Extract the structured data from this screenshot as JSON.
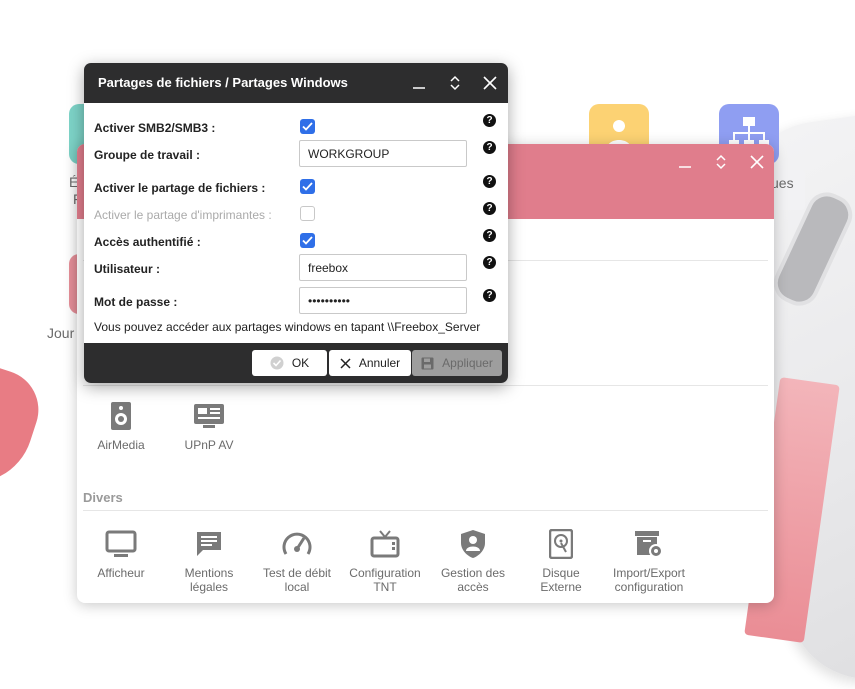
{
  "desktop": {
    "icons": [
      {
        "name": "desktop-icon-user",
        "color": "#fcd273"
      },
      {
        "name": "desktop-icon-network",
        "color": "#8f9ef2"
      }
    ],
    "partial_labels": {
      "left_top": "É",
      "left_mid": "F",
      "left_bottom": "Jour",
      "right": "ues"
    }
  },
  "back_window": {
    "header_color": "#e07d8c",
    "media_items": [
      {
        "label": "AirMedia",
        "icon": "speaker-icon"
      },
      {
        "label": "UPnP AV",
        "icon": "upnp-icon"
      }
    ],
    "sections": {
      "misc_title": "Divers"
    },
    "misc_items": [
      {
        "label": "Afficheur",
        "icon": "monitor-icon"
      },
      {
        "label": "Mentions\nlégales",
        "icon": "comment-icon"
      },
      {
        "label": "Test de débit\nlocal",
        "icon": "gauge-icon"
      },
      {
        "label": "Configuration\nTNT",
        "icon": "tv-icon"
      },
      {
        "label": "Gestion des\naccès",
        "icon": "shield-user-icon"
      },
      {
        "label": "Disque\nExterne",
        "icon": "hard-disk-icon"
      },
      {
        "label": "Import/Export\nconfiguration",
        "icon": "archive-settings-icon"
      }
    ]
  },
  "dialog": {
    "title": "Partages de fichiers / Partages Windows",
    "rows": {
      "smb_label": "Activer SMB2/SMB3 :",
      "smb_checked": true,
      "workgroup_label": "Groupe de travail :",
      "workgroup_value": "WORKGROUP",
      "file_share_label": "Activer le partage de fichiers :",
      "file_share_checked": true,
      "printer_share_label": "Activer le partage d'imprimantes :",
      "printer_share_checked": false,
      "auth_label": "Accès authentifié :",
      "auth_checked": true,
      "user_label": "Utilisateur :",
      "user_value": "freebox",
      "password_label": "Mot de passe :",
      "password_value": "••••••••••"
    },
    "info_text": "Vous pouvez accéder aux partages windows en tapant \\\\Freebox_Server",
    "help_glyph": "?",
    "buttons": {
      "ok": "OK",
      "cancel": "Annuler",
      "apply": "Appliquer"
    }
  },
  "colors": {
    "checkbox_on": "#2f6fe8",
    "dialog_dark": "#2d2d2e",
    "accent_pink": "#e07d8c"
  }
}
